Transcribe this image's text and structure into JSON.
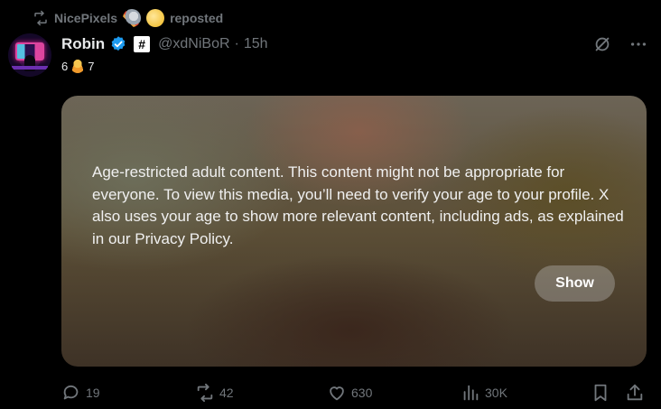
{
  "repost": {
    "user": "NicePixels",
    "label": "reposted",
    "emojis": [
      "rocket-emoji",
      "moon-emoji"
    ]
  },
  "author": {
    "name": "Robin",
    "badge_text": "#",
    "handle": "@xdNiBoR",
    "separator": "·",
    "time": "15h"
  },
  "subline": {
    "left": "6",
    "right": "7",
    "emoji": "person-emoji"
  },
  "media": {
    "notice": "Age-restricted adult content. This content might not be appropriate for everyone. To view this media, you’ll need to verify your age to your profile. X also uses your age to show more relevant content, including ads, as explained in our Privacy Policy.",
    "show_label": "Show"
  },
  "actions": {
    "replies": "19",
    "reposts": "42",
    "likes": "630",
    "views": "30K"
  },
  "colors": {
    "background": "#000000",
    "muted": "#71767b",
    "text": "#e7e9ea",
    "verified": "#1d9bf0"
  }
}
